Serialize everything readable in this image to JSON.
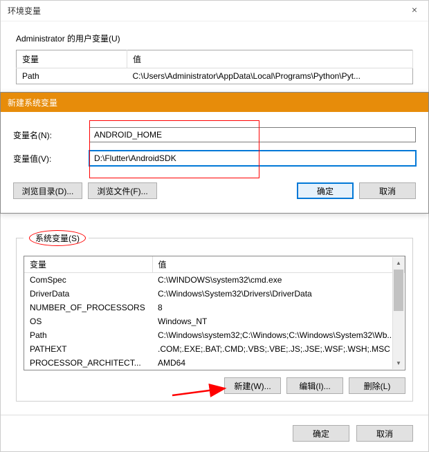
{
  "main_dialog": {
    "title": "环境变量",
    "close_glyph": "×",
    "user_section_label": "Administrator 的用户变量(U)",
    "table_headers": {
      "var": "变量",
      "val": "值"
    },
    "user_vars": [
      {
        "name": "Path",
        "value": "C:\\Users\\Administrator\\AppData\\Local\\Programs\\Python\\Pyt..."
      }
    ],
    "sys_section_legend": "系统变量(S)",
    "sys_vars": [
      {
        "name": "ComSpec",
        "value": "C:\\WINDOWS\\system32\\cmd.exe"
      },
      {
        "name": "DriverData",
        "value": "C:\\Windows\\System32\\Drivers\\DriverData"
      },
      {
        "name": "NUMBER_OF_PROCESSORS",
        "value": "8"
      },
      {
        "name": "OS",
        "value": "Windows_NT"
      },
      {
        "name": "Path",
        "value": "C:\\Windows\\system32;C:\\Windows;C:\\Windows\\System32\\Wb..."
      },
      {
        "name": "PATHEXT",
        "value": ".COM;.EXE;.BAT;.CMD;.VBS;.VBE;.JS;.JSE;.WSF;.WSH;.MSC"
      },
      {
        "name": "PROCESSOR_ARCHITECT...",
        "value": "AMD64"
      }
    ],
    "sys_buttons": {
      "new": "新建(W)...",
      "edit": "编辑(I)...",
      "delete": "删除(L)"
    },
    "bottom_buttons": {
      "ok": "确定",
      "cancel": "取消"
    }
  },
  "overlay_dialog": {
    "title": "新建系统变量",
    "label_name": "变量名(N):",
    "label_value": "变量值(V):",
    "input_name": "ANDROID_HOME",
    "input_value": "D:\\Flutter\\AndroidSDK",
    "btn_browse_dir": "浏览目录(D)...",
    "btn_browse_file": "浏览文件(F)...",
    "btn_ok": "确定",
    "btn_cancel": "取消"
  }
}
